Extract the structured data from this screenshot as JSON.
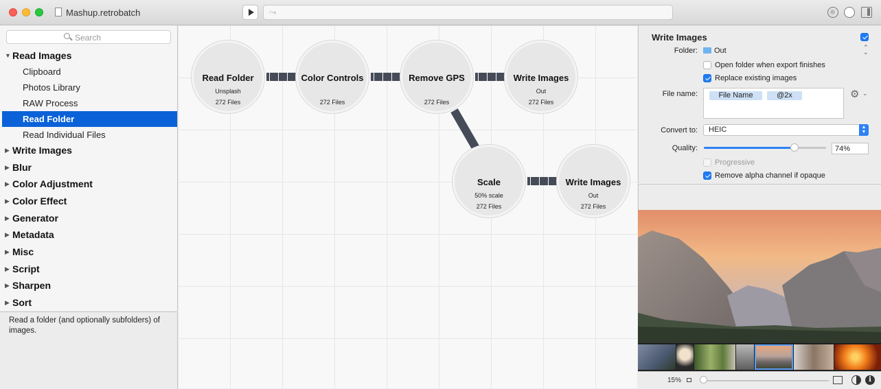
{
  "window": {
    "title": "Mashup.retrobatch"
  },
  "sidebar": {
    "search_placeholder": "Search",
    "categories": [
      {
        "label": "Read Images",
        "expanded": true,
        "items": [
          "Clipboard",
          "Photos Library",
          "RAW Process",
          "Read Folder",
          "Read Individual Files"
        ],
        "selected": "Read Folder"
      },
      {
        "label": "Write Images",
        "expanded": false
      },
      {
        "label": "Blur",
        "expanded": false
      },
      {
        "label": "Color Adjustment",
        "expanded": false
      },
      {
        "label": "Color Effect",
        "expanded": false
      },
      {
        "label": "Generator",
        "expanded": false
      },
      {
        "label": "Metadata",
        "expanded": false
      },
      {
        "label": "Misc",
        "expanded": false
      },
      {
        "label": "Script",
        "expanded": false
      },
      {
        "label": "Sharpen",
        "expanded": false
      },
      {
        "label": "Sort",
        "expanded": false
      }
    ],
    "description": "Read a folder (and optionally subfolders) of images."
  },
  "nodes": [
    {
      "title": "Read Folder",
      "subtitle": "Unsplash",
      "files": "272 Files"
    },
    {
      "title": "Color Controls",
      "subtitle": "",
      "files": "272 Files"
    },
    {
      "title": "Remove GPS",
      "subtitle": "",
      "files": "272 Files"
    },
    {
      "title": "Write Images",
      "subtitle": "Out",
      "files": "272 Files"
    },
    {
      "title": "Scale",
      "subtitle": "50% scale",
      "files": "272 Files"
    },
    {
      "title": "Write Images",
      "subtitle": "Out",
      "files": "272 Files"
    }
  ],
  "inspector": {
    "title": "Write Images",
    "enabled": true,
    "folder_label": "Folder:",
    "folder_value": "Out",
    "open_folder_label": "Open folder when export finishes",
    "open_folder_checked": false,
    "replace_label": "Replace existing images",
    "replace_checked": true,
    "file_name_label": "File name:",
    "file_name_tokens": [
      "File Name",
      "@2x"
    ],
    "convert_label": "Convert to:",
    "convert_value": "HEIC",
    "quality_label": "Quality:",
    "quality_value": "74%",
    "quality_fraction": 0.74,
    "progressive_label": "Progressive",
    "progressive_checked": false,
    "progressive_enabled": false,
    "remove_alpha_label": "Remove alpha channel if opaque",
    "remove_alpha_checked": true
  },
  "preview": {
    "zoom": "15%",
    "thumbnails": 7,
    "selected_thumbnail": 4
  },
  "colors": {
    "selection": "#0b62d8",
    "accent": "#2b82f5",
    "connector": "#454b57"
  },
  "icons": [
    "play-icon",
    "status-icon",
    "search-icon",
    "folder-icon",
    "gear-icon",
    "info-icon",
    "contrast-icon"
  ]
}
